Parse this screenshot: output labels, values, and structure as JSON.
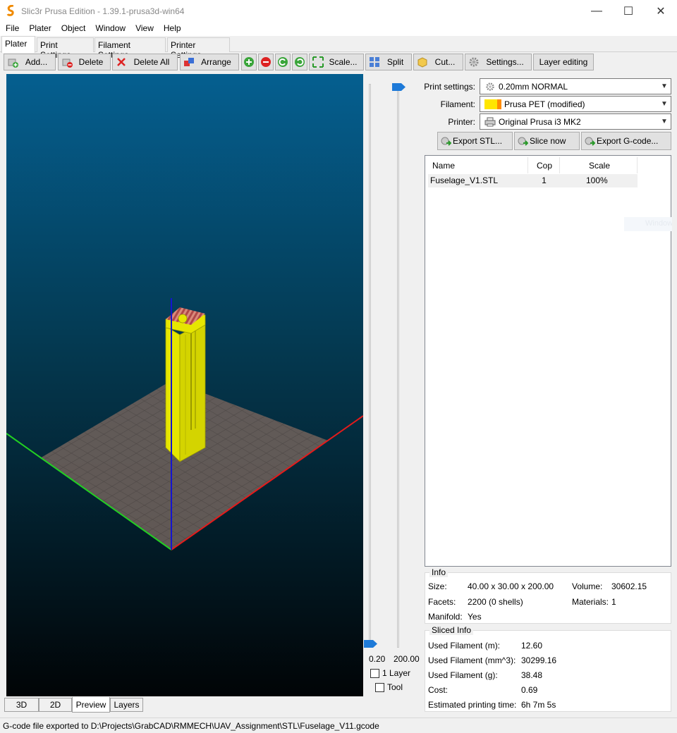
{
  "window": {
    "title": "Slic3r Prusa Edition - 1.39.1-prusa3d-win64",
    "controls": {
      "minimize": "—",
      "maximize": "☐",
      "close": "✕"
    }
  },
  "menu": [
    "File",
    "Plater",
    "Object",
    "Window",
    "View",
    "Help"
  ],
  "tabs": [
    "Plater",
    "Print Settings",
    "Filament Settings",
    "Printer Settings"
  ],
  "toolbar": {
    "add": "Add...",
    "delete": "Delete",
    "delete_all": "Delete All",
    "arrange": "Arrange",
    "scale": "Scale...",
    "split": "Split",
    "cut": "Cut...",
    "settings": "Settings...",
    "layer_editing": "Layer editing"
  },
  "settings": {
    "print_label": "Print settings:",
    "print_value": "0.20mm NORMAL",
    "filament_label": "Filament:",
    "filament_value": "Prusa PET (modified)",
    "filament_colors": [
      "#ffe600",
      "#ff8c00"
    ],
    "printer_label": "Printer:",
    "printer_value": "Original Prusa i3 MK2"
  },
  "actions": {
    "export_stl": "Export STL...",
    "slice_now": "Slice now",
    "export_gcode": "Export G-code..."
  },
  "object_list": {
    "headers": [
      "Name",
      "Cop",
      "Scale"
    ],
    "rows": [
      {
        "name": "Fuselage_V1.STL",
        "copies": "1",
        "scale": "100%"
      }
    ],
    "ghost_text": "Windows"
  },
  "info": {
    "title": "Info",
    "size_label": "Size:",
    "size_value": "40.00 x 30.00 x 200.00",
    "volume_label": "Volume:",
    "volume_value": "30602.15",
    "facets_label": "Facets:",
    "facets_value": "2200 (0 shells)",
    "materials_label": "Materials:",
    "materials_value": "1",
    "manifold_label": "Manifold:",
    "manifold_value": "Yes"
  },
  "sliced_info": {
    "title": "Sliced Info",
    "used_m_label": "Used Filament (m):",
    "used_m_value": "12.60",
    "used_mm3_label": "Used Filament (mm^3):",
    "used_mm3_value": "30299.16",
    "used_g_label": "Used Filament (g):",
    "used_g_value": "38.48",
    "cost_label": "Cost:",
    "cost_value": "0.69",
    "time_label": "Estimated printing time:",
    "time_value": "6h 7m 5s"
  },
  "layer_slider": {
    "min_value": "0.20",
    "max_value": "200.00",
    "one_layer_label": "1 Layer",
    "tool_label": "Tool",
    "handle_color": "#1e7ad8"
  },
  "view_tabs": [
    "3D",
    "2D",
    "Preview",
    "Layers"
  ],
  "active_view_tab": "Preview",
  "status": "G-code file exported to D:\\Projects\\GrabCAD\\RMMECH\\UAV_Assignment\\STL\\Fuselage_V11.gcode",
  "colors": {
    "model_yellow": "#e6e600",
    "axis_x": "#e41b1b",
    "axis_y": "#22d022",
    "axis_z": "#1414d0",
    "bed": "#6b5f5a"
  }
}
